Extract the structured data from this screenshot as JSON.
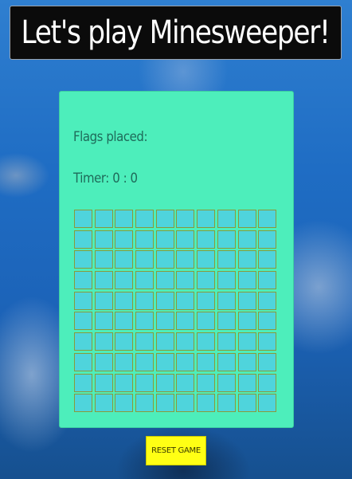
{
  "header": {
    "title": "Let's play Minesweeper!"
  },
  "panel": {
    "flags_label": "Flags placed:",
    "timer_label": "Timer: 0 : 0"
  },
  "board": {
    "rows": 10,
    "columns": 10
  },
  "controls": {
    "reset_label": "RESET GAME"
  },
  "colors": {
    "panel": "#4deebb",
    "cell": "#4fd4dc",
    "cell_border": "#8a9a3a",
    "reset_button": "#ffff14",
    "title_bar": "#0b0b0b"
  }
}
